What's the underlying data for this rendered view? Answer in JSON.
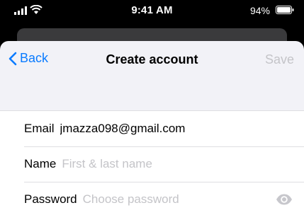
{
  "status_bar": {
    "time": "9:41 AM",
    "battery_percent": "94%",
    "icons": [
      "signal-icon",
      "wifi-icon",
      "battery-icon"
    ]
  },
  "nav": {
    "back_label": "Back",
    "title": "Create account",
    "save_label": "Save"
  },
  "form": {
    "email": {
      "label": "Email",
      "value": "jmazza098@gmail.com"
    },
    "name": {
      "label": "Name",
      "placeholder": "First & last name"
    },
    "password": {
      "label": "Password",
      "placeholder": "Choose password",
      "toggle_icon": "eye-icon"
    }
  },
  "colors": {
    "accent": "#0a7bff",
    "disabled": "#c4c4c8",
    "sheet_background": "#f2f2f7"
  }
}
